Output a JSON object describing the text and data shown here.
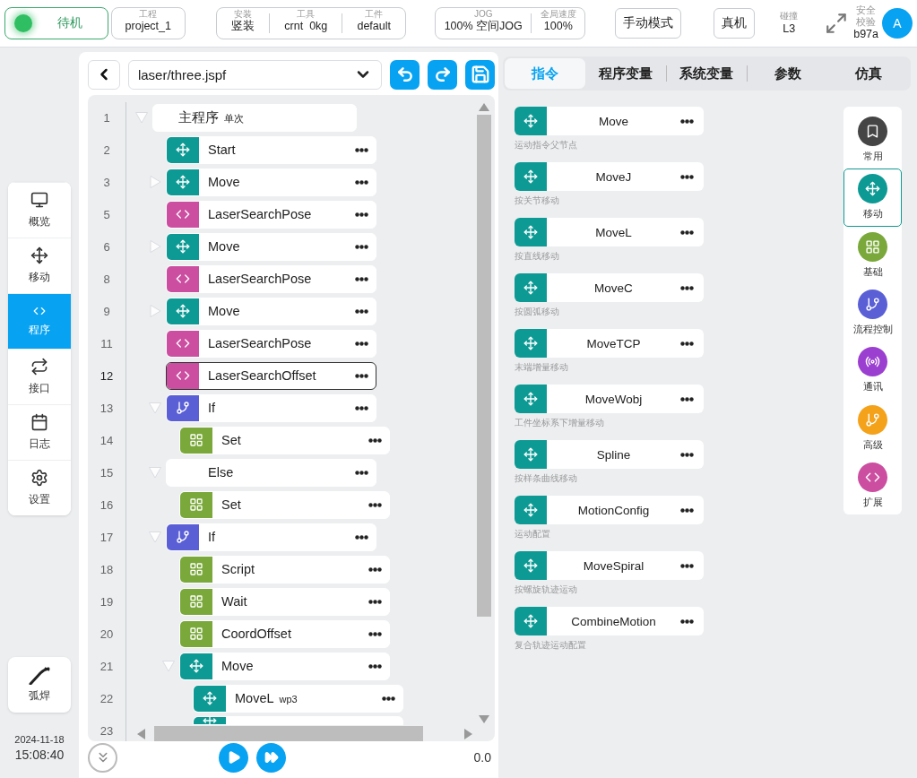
{
  "header": {
    "status": "待机",
    "project": {
      "label": "工程",
      "value": "project_1"
    },
    "install_group": [
      {
        "label": "安装",
        "value": "竖装"
      },
      {
        "label": "工具",
        "value": "crnt  0kg"
      },
      {
        "label": "工件",
        "value": "default"
      }
    ],
    "jog_group": [
      {
        "label": "JOG",
        "value": "100% 空间JOG"
      },
      {
        "label": "全局速度",
        "value": "100%"
      }
    ],
    "mode_button": "手动模式",
    "machine_button": "真机",
    "collision": {
      "label": "碰撞",
      "value": "L3"
    },
    "safety": {
      "label": "安全校验",
      "value": "b97a"
    },
    "avatar": "A"
  },
  "nav": [
    {
      "label": "概览",
      "selected": false
    },
    {
      "label": "移动",
      "selected": false
    },
    {
      "label": "程序",
      "selected": true
    },
    {
      "label": "接口",
      "selected": false
    },
    {
      "label": "日志",
      "selected": false
    },
    {
      "label": "设置",
      "selected": false
    }
  ],
  "tool_button": {
    "label": "弧焊"
  },
  "clock": {
    "date": "2024-11-18",
    "time": "15:08:40"
  },
  "program": {
    "file": "laser/three.jspf",
    "tree": [
      {
        "line": "1",
        "kind": "root",
        "label": "主程序",
        "note": "单次",
        "expanded": true,
        "selected": false,
        "children": [
          {
            "line": "2",
            "kind": "move",
            "label": "Start",
            "selected": false
          },
          {
            "line": "3",
            "kind": "move",
            "label": "Move",
            "expanded": false,
            "selected": false
          },
          {
            "line": "5",
            "kind": "script",
            "label": "LaserSearchPose",
            "selected": false
          },
          {
            "line": "6",
            "kind": "move",
            "label": "Move",
            "expanded": false,
            "selected": false
          },
          {
            "line": "8",
            "kind": "script",
            "label": "LaserSearchPose",
            "selected": false
          },
          {
            "line": "9",
            "kind": "move",
            "label": "Move",
            "expanded": false,
            "selected": false
          },
          {
            "line": "11",
            "kind": "script",
            "label": "LaserSearchPose",
            "selected": false
          },
          {
            "line": "12",
            "kind": "script",
            "label": "LaserSearchOffset",
            "selected": true
          },
          {
            "line": "13",
            "kind": "flow",
            "label": "If",
            "expanded": true,
            "selected": false,
            "children": [
              {
                "line": "14",
                "kind": "basic",
                "label": "Set",
                "selected": false
              }
            ]
          },
          {
            "line": "15",
            "kind": "plain",
            "label": "Else",
            "expanded": true,
            "selected": false,
            "children": [
              {
                "line": "16",
                "kind": "basic",
                "label": "Set",
                "selected": false
              }
            ]
          },
          {
            "line": "17",
            "kind": "flow",
            "label": "If",
            "expanded": true,
            "selected": false,
            "children": [
              {
                "line": "18",
                "kind": "basic",
                "label": "Script",
                "selected": false
              },
              {
                "line": "19",
                "kind": "basic",
                "label": "Wait",
                "selected": false
              },
              {
                "line": "20",
                "kind": "basic",
                "label": "CoordOffset",
                "selected": false
              },
              {
                "line": "21",
                "kind": "move",
                "label": "Move",
                "expanded": true,
                "selected": false,
                "children": [
                  {
                    "line": "22",
                    "kind": "move",
                    "label": "MoveL",
                    "note": "wp3",
                    "selected": false
                  },
                  {
                    "line": "23",
                    "kind": "move",
                    "selected": false
                  }
                ]
              }
            ]
          }
        ]
      }
    ],
    "speed": "0.0"
  },
  "tabs": [
    {
      "label": "指令",
      "selected": true
    },
    {
      "label": "程序变量",
      "selected": false
    },
    {
      "label": "系统变量",
      "selected": false
    },
    {
      "label": "参数",
      "selected": false
    },
    {
      "label": "仿真",
      "selected": false
    }
  ],
  "commands": [
    {
      "label": "Move",
      "description": "运动指令父节点"
    },
    {
      "label": "MoveJ",
      "description": "按关节移动"
    },
    {
      "label": "MoveL",
      "description": "按直线移动"
    },
    {
      "label": "MoveC",
      "description": "按圆弧移动"
    },
    {
      "label": "MoveTCP",
      "description": "末端增量移动"
    },
    {
      "label": "MoveWobj",
      "description": "工件坐标系下增量移动"
    },
    {
      "label": "Spline",
      "description": "按样条曲线移动"
    },
    {
      "label": "MotionConfig",
      "description": "运动配置"
    },
    {
      "label": "MoveSpiral",
      "description": "按螺旋轨迹运动"
    },
    {
      "label": "CombineMotion",
      "description": "复合轨迹运动配置"
    }
  ],
  "categories": [
    {
      "label": "常用",
      "kind": "common",
      "color": "#454545",
      "selected": false
    },
    {
      "label": "移动",
      "kind": "move",
      "color": "#0e9a94",
      "selected": true
    },
    {
      "label": "基础",
      "kind": "basic",
      "color": "#7aa83a",
      "selected": false
    },
    {
      "label": "流程控制",
      "kind": "flow",
      "color": "#5a5fd6",
      "selected": false
    },
    {
      "label": "通讯",
      "kind": "comm",
      "color": "#9b3fd1",
      "selected": false
    },
    {
      "label": "高级",
      "kind": "advanced",
      "color": "#f5a21b",
      "selected": false
    },
    {
      "label": "扩展",
      "kind": "extend",
      "color": "#cc4ea0",
      "selected": false
    }
  ]
}
